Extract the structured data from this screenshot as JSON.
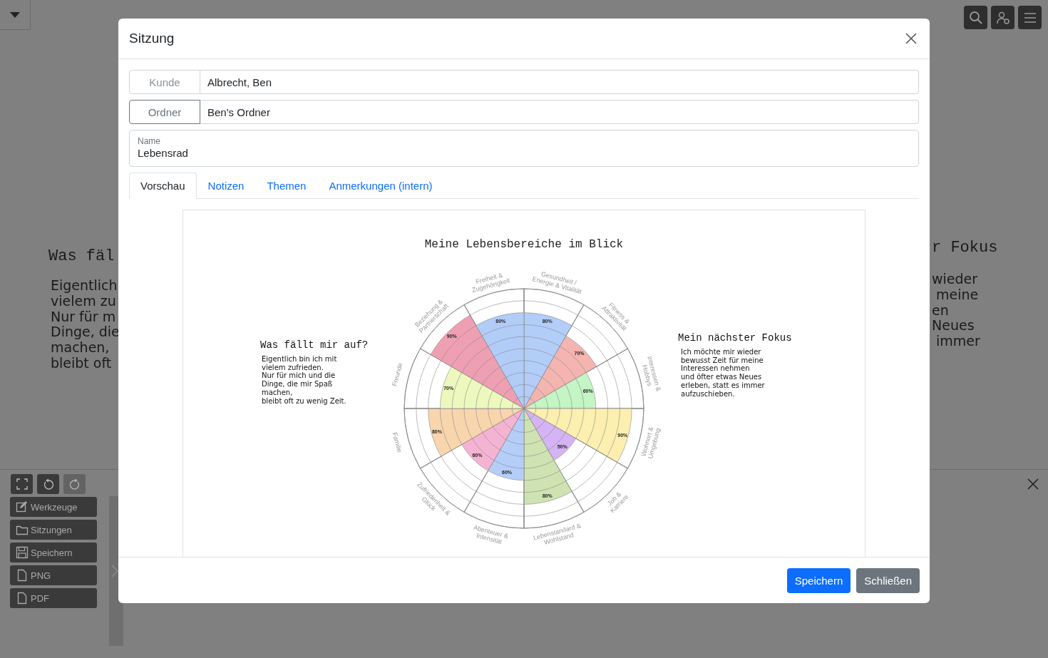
{
  "background": {
    "left_note": {
      "heading": "Was fäl",
      "text": "Eigentlich\nvielem zu\nNur für m\nDinge, die\nmachen,\nbleibt oft"
    },
    "right_note": {
      "heading": "r Fokus",
      "text": "wieder\n meine\nen\nNeues\n immer"
    }
  },
  "toolbar": {
    "tools": [
      {
        "kind": "fullscreen",
        "disabled": false
      },
      {
        "kind": "undo",
        "disabled": false
      },
      {
        "kind": "redo",
        "disabled": true
      }
    ],
    "menu": [
      {
        "kind": "edit",
        "label": "Werkzeuge"
      },
      {
        "kind": "folder",
        "label": "Sitzungen"
      },
      {
        "kind": "save",
        "label": "Speichern"
      },
      {
        "kind": "file",
        "label": "PNG"
      },
      {
        "kind": "file",
        "label": "PDF"
      }
    ]
  },
  "dialog": {
    "title": "Sitzung",
    "fields": [
      {
        "kind": "readonly",
        "label": "Kunde",
        "value": "Albrecht, Ben"
      },
      {
        "kind": "button",
        "label": "Ordner",
        "value": "Ben's Ordner"
      }
    ],
    "name_field": {
      "label": "Name",
      "value": "Lebensrad"
    },
    "tabs": [
      {
        "label": "Vorschau",
        "selected": true
      },
      {
        "label": "Notizen",
        "selected": false
      },
      {
        "label": "Themen",
        "selected": false
      },
      {
        "label": "Anmerkungen (intern)",
        "selected": false
      }
    ],
    "preview": {
      "title": "Meine Lebensbereiche im Blick",
      "left_note": {
        "heading": "Was fällt mir auf?",
        "text": "Eigentlich bin ich mit\nvielem zufrieden.\nNur für mich und die\nDinge, die mir Spaß\nmachen,\nbleibt oft zu wenig Zeit."
      },
      "right_note": {
        "heading": "Mein nächster Fokus",
        "text": "Ich möchte mir wieder\nbewusst Zeit für meine\nInteressen nehmen\nund öfter etwas Neues\nerleben, statt es immer\naufzuschieben."
      },
      "segments": [
        {
          "label": [
            "Gesundheit /",
            "Energie & Vitalität"
          ],
          "level": 0.8,
          "value": "80%",
          "color": "#b3cdf9"
        },
        {
          "label": [
            "Fitness &",
            "Attraktivität"
          ],
          "level": 0.7,
          "value": "70%",
          "color": "#f4b4b0"
        },
        {
          "label": [
            "Interessen &",
            "Hobbys"
          ],
          "level": 0.6,
          "value": "60%",
          "color": "#c4f5c4"
        },
        {
          "label": [
            "Wohnort &",
            "Umgebung"
          ],
          "level": 0.9,
          "value": "90%",
          "color": "#fcefb0"
        },
        {
          "label": [
            "Job &",
            "Karriere"
          ],
          "level": 0.5,
          "value": "50%",
          "color": "#d5b3f5"
        },
        {
          "label": [
            "Lebenstandard &",
            "Wohlstand"
          ],
          "level": 0.8,
          "value": "80%",
          "color": "#cfe3b2"
        },
        {
          "label": [
            "Abenteuer &",
            "Intensität"
          ],
          "level": 0.6,
          "value": "60%",
          "color": "#b4cef8"
        },
        {
          "label": [
            "Zufriedenheit &",
            "Glück"
          ],
          "level": 0.6,
          "value": "60%",
          "color": "#f5b3d3"
        },
        {
          "label": [
            "Familie"
          ],
          "level": 0.8,
          "value": "80%",
          "color": "#f9d5ae"
        },
        {
          "label": [
            "Freunde"
          ],
          "level": 0.7,
          "value": "70%",
          "color": "#ecf8bd"
        },
        {
          "label": [
            "Beziehung &",
            "Partnerschaft"
          ],
          "level": 0.9,
          "value": "90%",
          "color": "#ef9fb2"
        },
        {
          "label": [
            "Freiheit &",
            "Zugehörigkeit"
          ],
          "level": 0.8,
          "value": "80%",
          "color": "#b2ccf8"
        }
      ]
    },
    "buttons": [
      {
        "kind": "primary",
        "label": "Speichern"
      },
      {
        "kind": "secondary",
        "label": "Schließen"
      }
    ]
  }
}
